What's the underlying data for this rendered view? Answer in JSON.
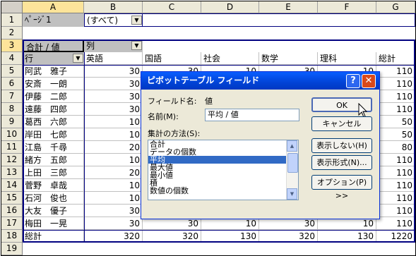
{
  "columns": [
    "A",
    "B",
    "C",
    "D",
    "E",
    "F",
    "G"
  ],
  "rows": [
    "1",
    "2",
    "3",
    "4",
    "5",
    "6",
    "7",
    "8",
    "9",
    "10",
    "11",
    "12",
    "13",
    "14",
    "15",
    "16",
    "17",
    "18",
    "19"
  ],
  "page_field": {
    "label": "ﾍﾟｰｼﾞ1",
    "value": "(すべて)"
  },
  "data_header": {
    "label": "合計 / 値",
    "col_field": "列",
    "row_field": "行"
  },
  "col_items": [
    "英語",
    "国語",
    "社会",
    "数学",
    "理科",
    "総計"
  ],
  "names": [
    "阿武　雅子",
    "安斎　一朗",
    "伊藤　二郎",
    "遠藤　四郎",
    "葛西　六郎",
    "岸田　七郎",
    "江島　千尋",
    "緒方　五郎",
    "上田　三郎",
    "菅野　卓哉",
    "石河　俊也",
    "大友　優子",
    "梅田　一晃"
  ],
  "english": [
    "30",
    "30",
    "30",
    "30",
    "10",
    "10",
    "20",
    "10",
    "20",
    "10",
    "10",
    "30",
    "30"
  ],
  "grandrow": {
    "label": "総計",
    "vals": [
      "320",
      "320",
      "130",
      "320",
      "130",
      "1220"
    ]
  },
  "r5": [
    "30",
    "30",
    "10",
    "30",
    "10",
    "110"
  ],
  "r16": [
    "30",
    "30",
    "10",
    "30",
    "10",
    "110"
  ],
  "r17": [
    "30",
    "30",
    "10",
    "30",
    "10",
    "110"
  ],
  "totals": [
    "110",
    "110",
    "110",
    "110",
    "50",
    "50",
    "80",
    "110",
    "110",
    "110",
    "110",
    "110",
    "110"
  ],
  "dialog": {
    "title": "ピボットテーブル フィールド",
    "help": "?",
    "close": "✕",
    "field_name_label": "フィールド名:",
    "field_name_value": "値",
    "name_label": "名前(M):",
    "name_value": "平均 / 値",
    "method_label": "集計の方法(S):",
    "methods": [
      "合計",
      "データの個数",
      "平均",
      "最大値",
      "最小値",
      "積",
      "数値の個数"
    ],
    "selected_method": "平均",
    "buttons": {
      "ok": "OK",
      "cancel": "キャンセル",
      "hide": "表示しない(H)",
      "format": "表示形式(N)...",
      "options": "オプション(P) >>"
    }
  }
}
